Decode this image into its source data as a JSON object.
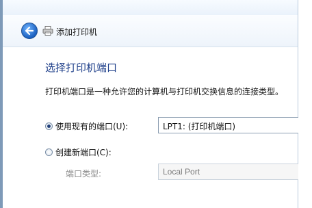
{
  "window": {
    "title": "添加打印机",
    "back_icon": "back-arrow-icon",
    "printer_icon": "printer-icon"
  },
  "page": {
    "heading": "选择打印机端口",
    "description": "打印机端口是一种允许您的计算机与打印机交换信息的连接类型。"
  },
  "options": {
    "use_existing": {
      "label": "使用现有的端口(U):",
      "checked": true
    },
    "existing_port_value": "LPT1: (打印机端口)",
    "create_new": {
      "label": "创建新端口(C):",
      "checked": false
    },
    "port_type_label": "端口类型:",
    "port_type_value": "Local Port"
  },
  "colors": {
    "heading": "#1e3f8a",
    "back_button": "#1a5fbf"
  }
}
